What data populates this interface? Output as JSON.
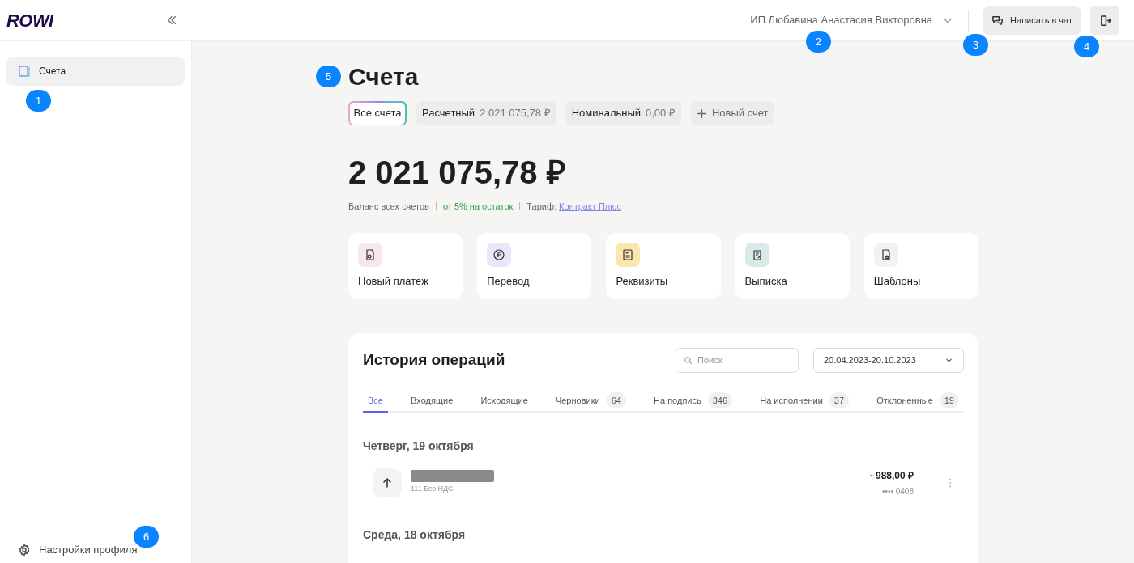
{
  "header": {
    "logo": "ROWI",
    "company": "ИП Любавина Анастасия Викторовна",
    "chat_button": "Написать в чат"
  },
  "sidebar": {
    "items": [
      {
        "label": "Счета",
        "selected": true
      }
    ],
    "footer": "Настройки профиля"
  },
  "page": {
    "title": "Счета",
    "accounts": [
      {
        "label": "Все счета",
        "kind": "all",
        "selected": true
      },
      {
        "label": "Расчетный",
        "amount": "2 021 075,78 ₽",
        "kind": "account",
        "selected": false
      },
      {
        "label": "Номинальный",
        "amount": "0,00 ₽",
        "kind": "account",
        "selected": false
      },
      {
        "label": "Новый счет",
        "kind": "add",
        "selected": false
      }
    ],
    "balance": "2 021 075,78 ₽",
    "balance_caption": "Баланс всех счетов",
    "interest": "от 5% на остаток",
    "tariff_label": "Тариф:",
    "tariff_link": "Контракт Плюс",
    "actions": [
      {
        "label": "Новый платеж",
        "kind": "payment",
        "color": "#f7e6ea"
      },
      {
        "label": "Перевод",
        "kind": "transfer",
        "color": "#e6e7fb"
      },
      {
        "label": "Реквизиты",
        "kind": "details",
        "color": "#fbe7ad"
      },
      {
        "label": "Выписка",
        "kind": "statement",
        "color": "#d9ebe8"
      },
      {
        "label": "Шаблоны",
        "kind": "template",
        "color": "#f2f2f2"
      }
    ]
  },
  "history": {
    "title": "История операций",
    "search_placeholder": "Поиск",
    "date_range": "20.04.2023-20.10.2023",
    "tabs": [
      {
        "label": "Все",
        "selected": true
      },
      {
        "label": "Входящие",
        "selected": false
      },
      {
        "label": "Исходящие",
        "selected": false
      },
      {
        "label": "Черновики",
        "count": "64",
        "selected": false
      },
      {
        "label": "На подпись",
        "count": "346",
        "selected": false
      },
      {
        "label": "На исполнении",
        "count": "37",
        "selected": false
      },
      {
        "label": "Отклоненные",
        "count": "19",
        "selected": false
      }
    ],
    "days": [
      {
        "date": "Четверг, 19 октября",
        "operations": [
          {
            "kind": "outgoing",
            "name_redacted": true,
            "note": "111 Без НДС",
            "amount": "- 988,00 ₽",
            "account": "•••• 0408"
          }
        ]
      },
      {
        "date": "Среда, 18 октября"
      }
    ]
  },
  "callouts": [
    "1",
    "2",
    "3",
    "4",
    "5",
    "6"
  ]
}
